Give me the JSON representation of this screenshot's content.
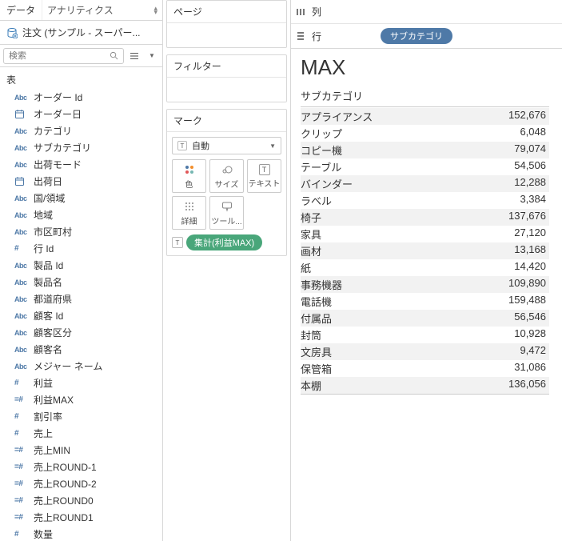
{
  "sidebar": {
    "tabs": {
      "data": "データ",
      "analytics": "アナリティクス"
    },
    "datasource": "注文 (サンプル - スーパー...",
    "search_placeholder": "検索",
    "tables_header": "表",
    "fields": [
      {
        "icon": "Abc",
        "label": "オーダー Id"
      },
      {
        "icon": "date",
        "label": "オーダー日"
      },
      {
        "icon": "Abc",
        "label": "カテゴリ"
      },
      {
        "icon": "Abc",
        "label": "サブカテゴリ"
      },
      {
        "icon": "Abc",
        "label": "出荷モード"
      },
      {
        "icon": "date",
        "label": "出荷日"
      },
      {
        "icon": "Abc",
        "label": "国/領域"
      },
      {
        "icon": "Abc",
        "label": "地域"
      },
      {
        "icon": "Abc",
        "label": "市区町村"
      },
      {
        "icon": "num",
        "label": "行 Id"
      },
      {
        "icon": "Abc",
        "label": "製品 Id"
      },
      {
        "icon": "Abc",
        "label": "製品名"
      },
      {
        "icon": "Abc",
        "label": "都道府県"
      },
      {
        "icon": "Abc",
        "label": "顧客 Id"
      },
      {
        "icon": "Abc",
        "label": "顧客区分"
      },
      {
        "icon": "Abc",
        "label": "顧客名"
      },
      {
        "icon": "Abc",
        "label": "メジャー ネーム"
      },
      {
        "icon": "num",
        "label": "利益"
      },
      {
        "icon": "calc",
        "label": "利益MAX"
      },
      {
        "icon": "num",
        "label": "割引率"
      },
      {
        "icon": "num",
        "label": "売上"
      },
      {
        "icon": "calc",
        "label": "売上MIN"
      },
      {
        "icon": "calc",
        "label": "売上ROUND-1"
      },
      {
        "icon": "calc",
        "label": "売上ROUND-2"
      },
      {
        "icon": "calc",
        "label": "売上ROUND0"
      },
      {
        "icon": "calc",
        "label": "売上ROUND1"
      },
      {
        "icon": "num",
        "label": "数量"
      }
    ]
  },
  "cards": {
    "pages": "ページ",
    "filters": "フィルター",
    "marks": "マーク",
    "mark_type": "自動",
    "mark_buttons": {
      "color": "色",
      "size": "サイズ",
      "text": "テキスト",
      "detail": "詳細",
      "tooltip": "ツール..."
    },
    "mark_pill": "集計(利益MAX)"
  },
  "shelves": {
    "columns": "列",
    "rows": "行",
    "row_pill": "サブカテゴリ"
  },
  "viz": {
    "title": "MAX",
    "subhead": "サブカテゴリ"
  },
  "chart_data": {
    "type": "table",
    "title": "MAX",
    "column": "サブカテゴリ",
    "rows": [
      {
        "category": "アプライアンス",
        "value": 152676
      },
      {
        "category": "クリップ",
        "value": 6048
      },
      {
        "category": "コピー機",
        "value": 79074
      },
      {
        "category": "テーブル",
        "value": 54506
      },
      {
        "category": "バインダー",
        "value": 12288
      },
      {
        "category": "ラベル",
        "value": 3384
      },
      {
        "category": "椅子",
        "value": 137676
      },
      {
        "category": "家具",
        "value": 27120
      },
      {
        "category": "画材",
        "value": 13168
      },
      {
        "category": "紙",
        "value": 14420
      },
      {
        "category": "事務機器",
        "value": 109890
      },
      {
        "category": "電話機",
        "value": 159488
      },
      {
        "category": "付属品",
        "value": 56546
      },
      {
        "category": "封筒",
        "value": 10928
      },
      {
        "category": "文房具",
        "value": 9472
      },
      {
        "category": "保管箱",
        "value": 31086
      },
      {
        "category": "本棚",
        "value": 136056
      }
    ]
  }
}
